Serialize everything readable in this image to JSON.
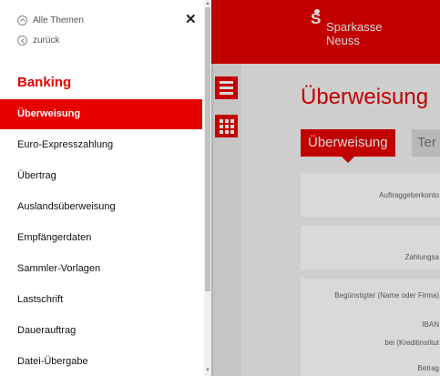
{
  "header": {
    "brand_name": "Sparkasse Neuss",
    "brand_letter": "S",
    "accent_color": "#e60000"
  },
  "main": {
    "title": "Überweisung",
    "tabs": [
      {
        "label": "Überweisung"
      },
      {
        "label": "Ter"
      }
    ],
    "fields": [
      "Auftraggeberkonto",
      "Zahlungsa",
      "Begünstigter (Name oder Firma)",
      "IBAN",
      "bei (Kreditinstitut",
      "Betrag"
    ]
  },
  "nav": {
    "all_topics": "Alle Themen",
    "back": "zurück",
    "section": "Banking",
    "items": [
      {
        "label": "Überweisung",
        "active": true
      },
      {
        "label": "Euro-Expresszahlung"
      },
      {
        "label": "Übertrag"
      },
      {
        "label": "Auslandsüberweisung"
      },
      {
        "label": "Empfängerdaten"
      },
      {
        "label": "Sammler-Vorlagen"
      },
      {
        "label": "Lastschrift"
      },
      {
        "label": "Dauerauftrag"
      },
      {
        "label": "Datei-Übergabe"
      }
    ]
  }
}
